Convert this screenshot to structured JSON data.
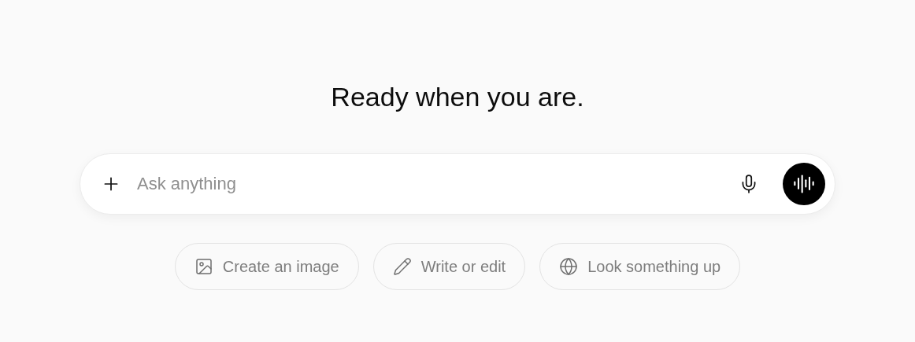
{
  "heading": "Ready when you are.",
  "composer": {
    "placeholder": "Ask anything"
  },
  "suggestions": [
    {
      "kind": "image",
      "label": "Create an image"
    },
    {
      "kind": "write",
      "label": "Write or edit"
    },
    {
      "kind": "search",
      "label": "Look something up"
    }
  ]
}
